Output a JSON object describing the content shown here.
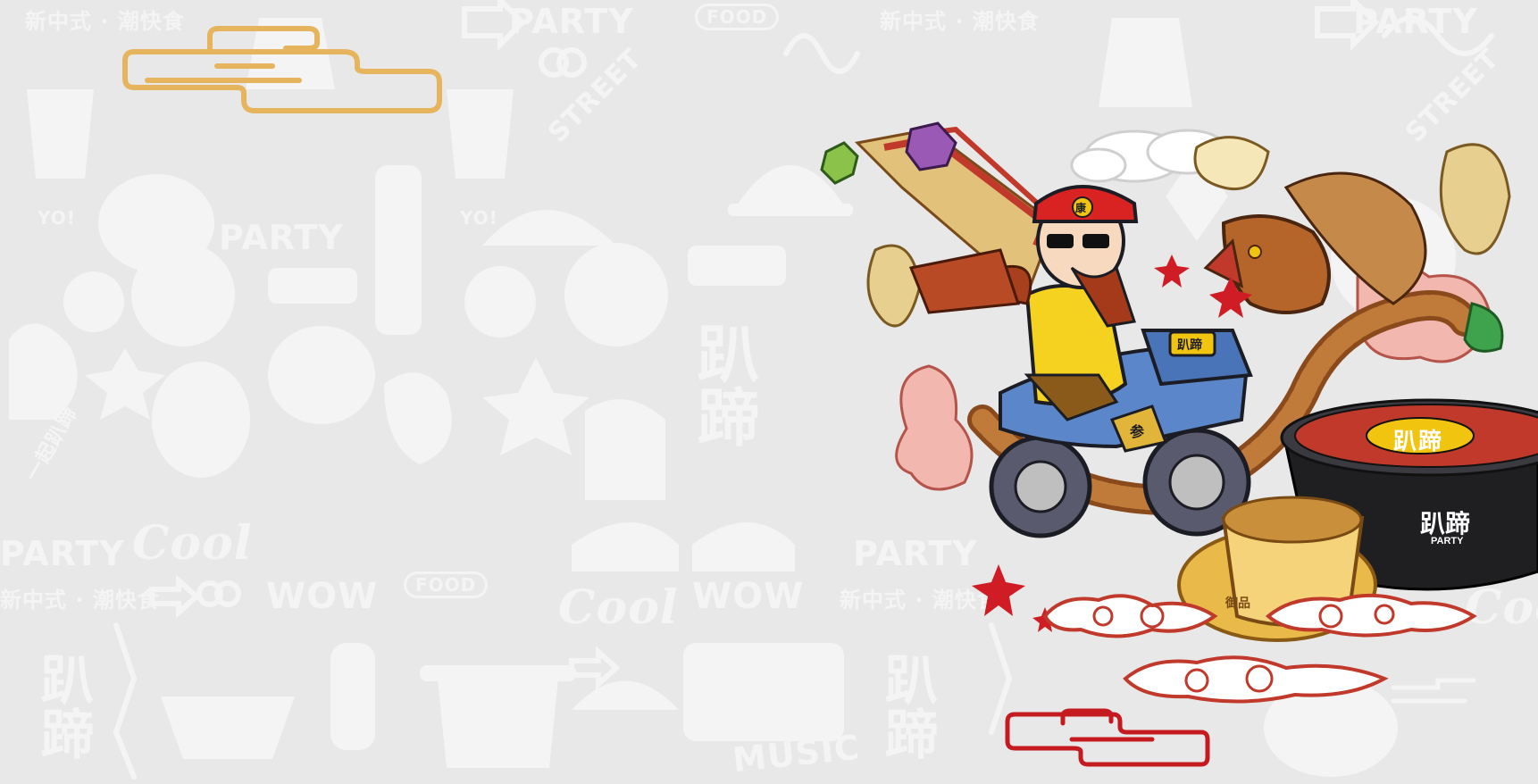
{
  "poster": {
    "background_color": "#e8e8e8",
    "pattern_color": "#f4f4f4",
    "cloud_gold_color": "#e7b45e",
    "cloud_red_color": "#c41a20"
  },
  "pattern_text": {
    "slogan": "新中式 · 潮快食",
    "party": "PARTY",
    "cool": "Cool",
    "wow": "WOW",
    "food": "FOOD",
    "music": "MUSIC",
    "street": "STREET",
    "yo": "YO!",
    "brand": "趴蹄",
    "together": "一起趴蹄"
  },
  "illustration": {
    "hat_badge": "康",
    "bike_plate": "趴蹄",
    "fender_mark": "参",
    "cup_text": "御品",
    "bowl_lid": "趴蹄",
    "bowl_brand": "趴蹄",
    "bowl_sub": "PARTY"
  }
}
